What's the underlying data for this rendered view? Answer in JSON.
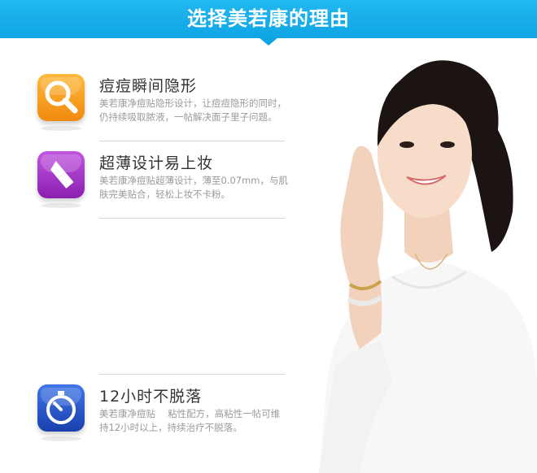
{
  "header": {
    "title": "选择美若康的理由",
    "color": "#0fa4e4"
  },
  "features": [
    {
      "title": "痘痘瞬间隐形",
      "desc": "美若康净痘贴隐形设计，让痘痘隐形的同时，仍持续吸取脓液，一帖解决面子里子问题。",
      "icon": "magnifier-icon",
      "color": "#f39a1c"
    },
    {
      "title": "超薄设计易上妆",
      "desc": "美若康净痘贴超薄设计，薄至0.07mm，与肌肤完美贴合，轻松上妆不卡粉。",
      "icon": "lipstick-icon",
      "color": "#a12cc4"
    },
    {
      "title": "12小时不脱落",
      "desc": "美若康净痘贴　 粘性配方，高粘性一帖可维持12小时以上，持续治疗不脱落。",
      "icon": "stopwatch-icon",
      "color": "#1d4fc4"
    }
  ]
}
